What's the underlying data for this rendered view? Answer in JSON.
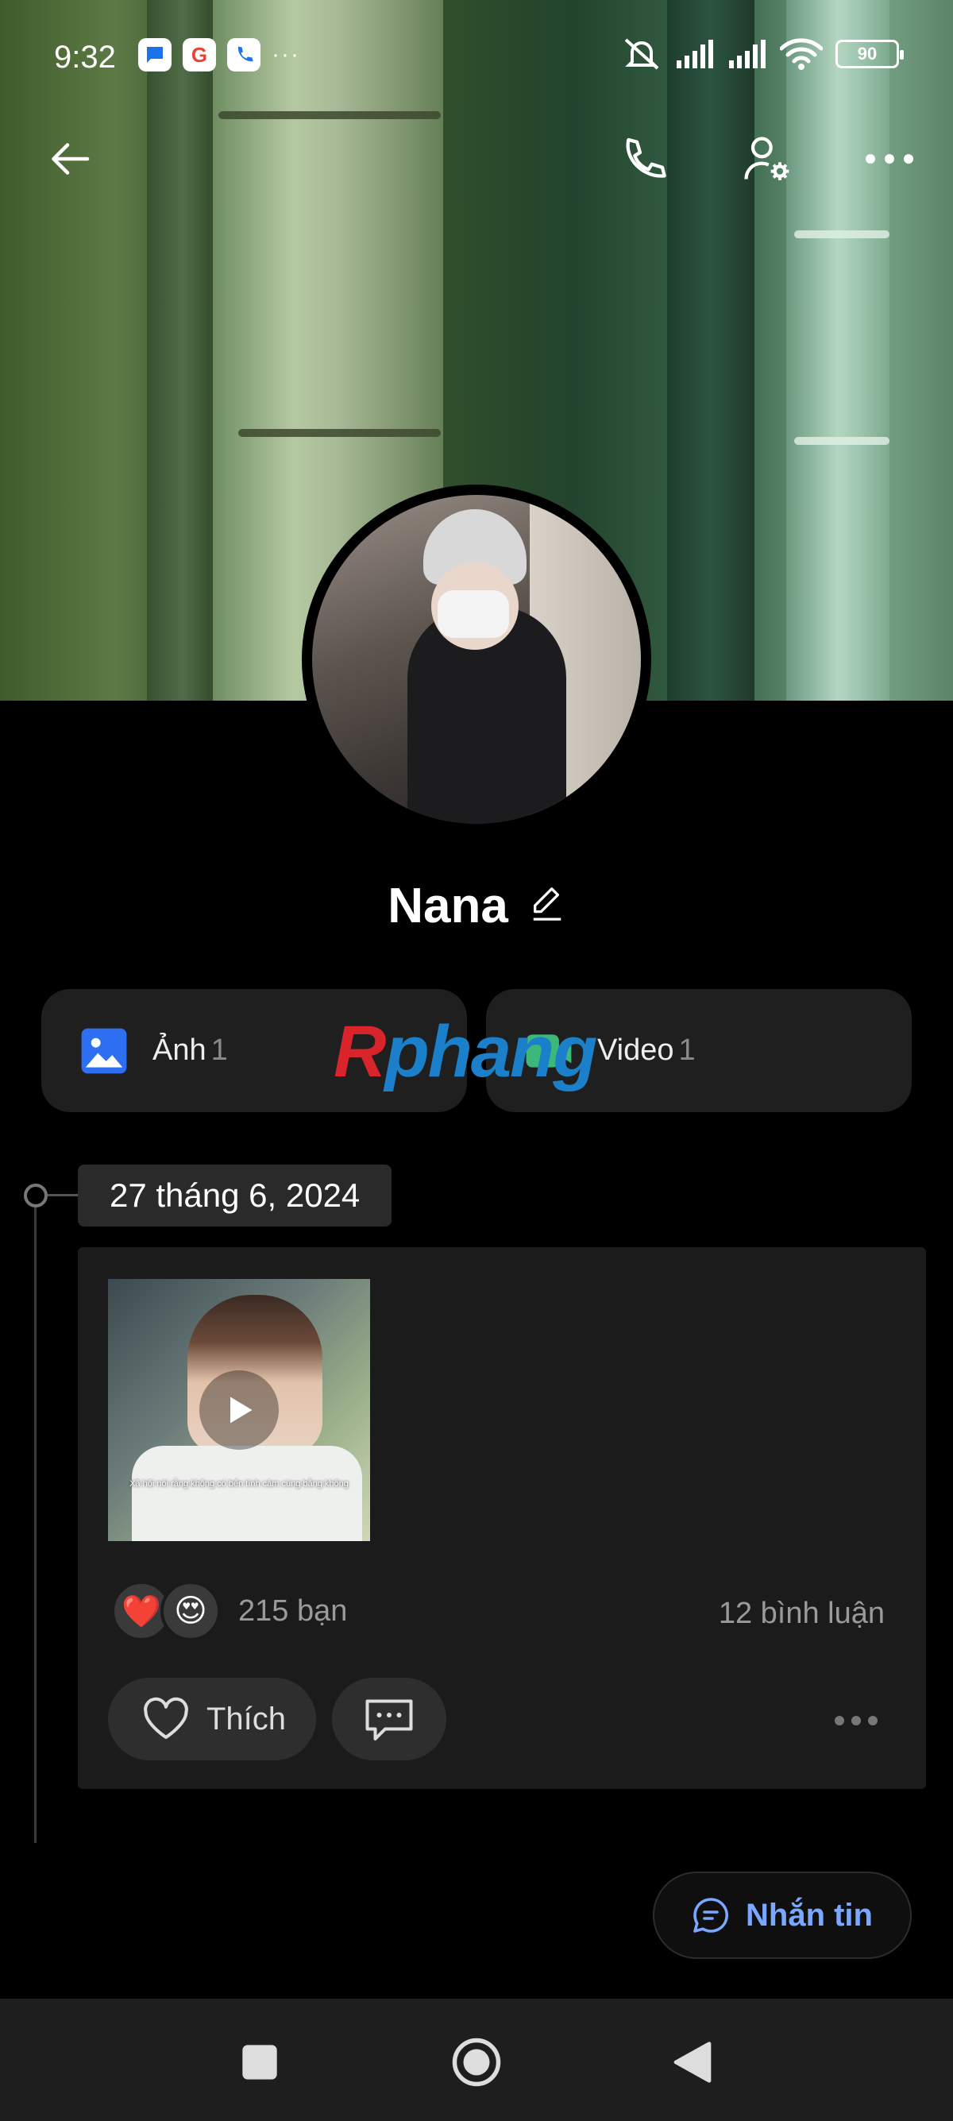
{
  "status_bar": {
    "time": "9:32",
    "notification_icons": [
      "messages-icon",
      "google-icon",
      "phone-app-icon"
    ],
    "overflow": "···",
    "battery": "90"
  },
  "topbar": {
    "icons": [
      "back-arrow-icon",
      "phone-icon",
      "user-settings-icon",
      "more-horizontal-icon"
    ]
  },
  "profile": {
    "name": "Nana"
  },
  "media_tabs": [
    {
      "label": "Ảnh",
      "count": "1",
      "icon": "image-icon"
    },
    {
      "label": "Video",
      "count": "1",
      "icon": "video-icon"
    }
  ],
  "watermark": {
    "part1": "R",
    "part2": "phang"
  },
  "timeline": {
    "date": "27 tháng 6, 2024"
  },
  "post": {
    "video_caption": "Xã hội nói rằng không có bến tình cảm cùng bằng không",
    "reactions": [
      "❤️",
      "😍"
    ],
    "reaction_count": "215 bạn",
    "comment_count": "12 bình luận",
    "like_label": "Thích"
  },
  "message_button": {
    "label": "Nhắn tin"
  },
  "colors": {
    "accent_link": "#7aa7ff",
    "card_bg": "#1f1f1f",
    "image_icon": "#2d6ff0",
    "video_icon": "#3cb97a"
  }
}
